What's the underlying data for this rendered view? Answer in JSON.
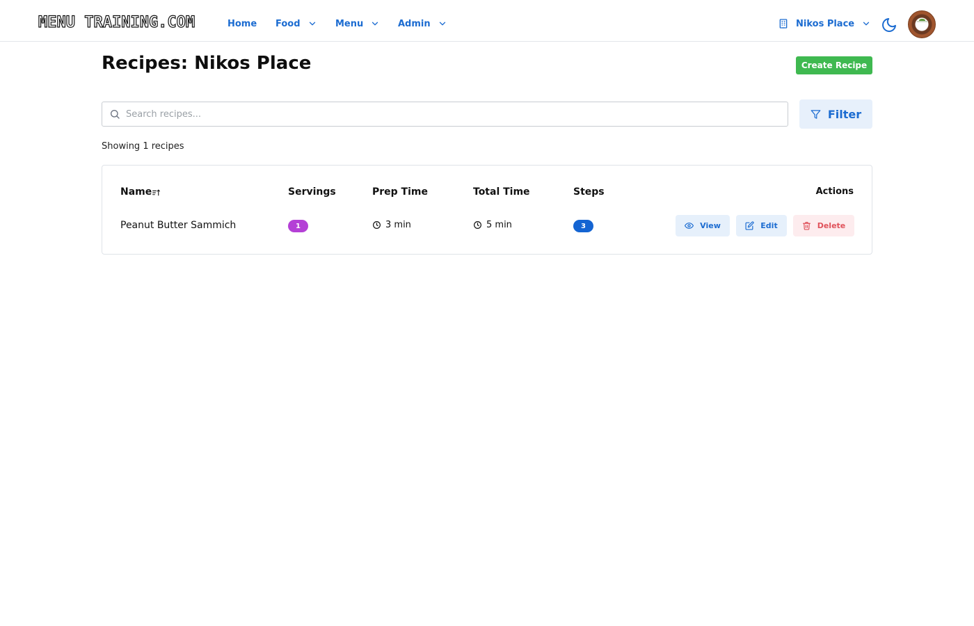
{
  "brand": {
    "logo_text": "MENU TRAINING.COM"
  },
  "nav": {
    "items": [
      {
        "label": "Home"
      },
      {
        "label": "Food"
      },
      {
        "label": "Menu"
      },
      {
        "label": "Admin"
      }
    ],
    "restaurant_label": "Nikos Place"
  },
  "page": {
    "title": "Recipes: Nikos Place",
    "create_label": "Create Recipe"
  },
  "search": {
    "placeholder": "Search recipes...",
    "value": ""
  },
  "filter": {
    "label": "Filter"
  },
  "results": {
    "count_text": "Showing 1 recipes"
  },
  "table": {
    "columns": {
      "name": "Name",
      "servings": "Servings",
      "prep": "Prep Time",
      "total": "Total Time",
      "steps": "Steps",
      "actions": "Actions"
    },
    "rows": [
      {
        "name": "Peanut Butter Sammich",
        "servings": "1",
        "prep_time": "3 min",
        "total_time": "5 min",
        "steps": "3",
        "view_label": "View",
        "edit_label": "Edit",
        "delete_label": "Delete"
      }
    ]
  },
  "colors": {
    "accent": "#1c6cd1",
    "create": "#3fb950",
    "servings_badge": "#b440d6",
    "steps_badge": "#1464d2",
    "delete": "#e0525b"
  },
  "icons": [
    "building-icon",
    "chevron-down-icon",
    "moon-icon",
    "search-icon",
    "filter-icon",
    "sort-icon",
    "clock-icon",
    "eye-icon",
    "edit-icon",
    "trash-icon"
  ]
}
